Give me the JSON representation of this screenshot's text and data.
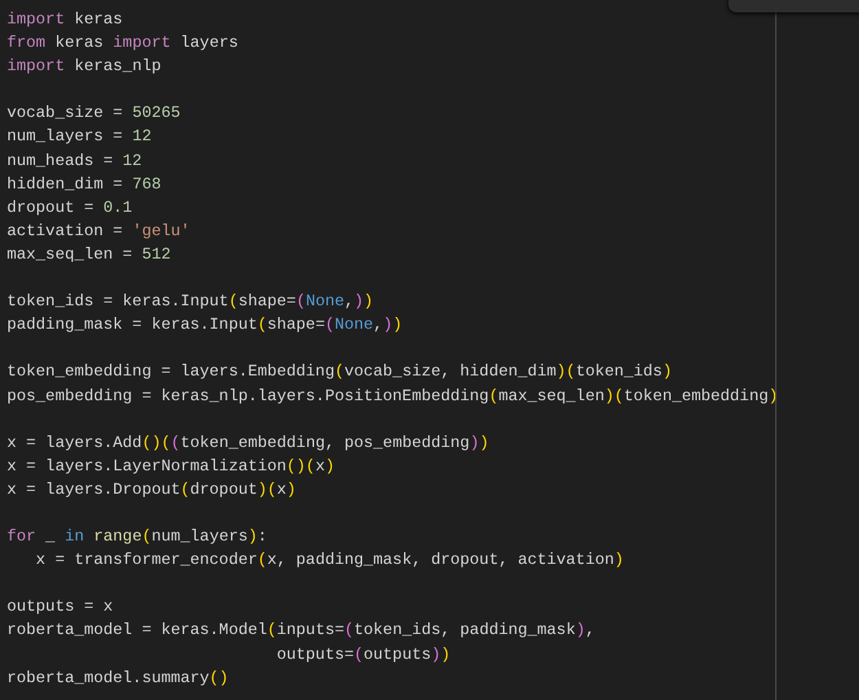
{
  "editor": {
    "lines": [
      {
        "kind": "code",
        "tokens": [
          {
            "kind": "keyword",
            "text": "import"
          },
          {
            "kind": "plain",
            "text": " keras"
          }
        ]
      },
      {
        "kind": "code",
        "tokens": [
          {
            "kind": "keyword",
            "text": "from"
          },
          {
            "kind": "plain",
            "text": " keras "
          },
          {
            "kind": "keyword",
            "text": "import"
          },
          {
            "kind": "plain",
            "text": " layers"
          }
        ]
      },
      {
        "kind": "code",
        "tokens": [
          {
            "kind": "keyword",
            "text": "import"
          },
          {
            "kind": "plain",
            "text": " keras_nlp"
          }
        ]
      },
      {
        "kind": "blank"
      },
      {
        "kind": "code",
        "tokens": [
          {
            "kind": "plain",
            "text": "vocab_size = "
          },
          {
            "kind": "number",
            "text": "50265"
          }
        ]
      },
      {
        "kind": "code",
        "tokens": [
          {
            "kind": "plain",
            "text": "num_layers = "
          },
          {
            "kind": "number",
            "text": "12"
          }
        ]
      },
      {
        "kind": "code",
        "tokens": [
          {
            "kind": "plain",
            "text": "num_heads = "
          },
          {
            "kind": "number",
            "text": "12"
          }
        ]
      },
      {
        "kind": "code",
        "tokens": [
          {
            "kind": "plain",
            "text": "hidden_dim = "
          },
          {
            "kind": "number",
            "text": "768"
          }
        ]
      },
      {
        "kind": "code",
        "tokens": [
          {
            "kind": "plain",
            "text": "dropout = "
          },
          {
            "kind": "number",
            "text": "0.1"
          }
        ]
      },
      {
        "kind": "code",
        "tokens": [
          {
            "kind": "plain",
            "text": "activation = "
          },
          {
            "kind": "string",
            "text": "'gelu'"
          }
        ]
      },
      {
        "kind": "code",
        "tokens": [
          {
            "kind": "plain",
            "text": "max_seq_len = "
          },
          {
            "kind": "number",
            "text": "512"
          }
        ]
      },
      {
        "kind": "blank"
      },
      {
        "kind": "code",
        "tokens": [
          {
            "kind": "plain",
            "text": "token_ids = keras.Input"
          },
          {
            "kind": "bracket1",
            "text": "("
          },
          {
            "kind": "plain",
            "text": "shape="
          },
          {
            "kind": "bracket2",
            "text": "("
          },
          {
            "kind": "constant",
            "text": "None"
          },
          {
            "kind": "plain",
            "text": ","
          },
          {
            "kind": "bracket2",
            "text": ")"
          },
          {
            "kind": "bracket1",
            "text": ")"
          }
        ]
      },
      {
        "kind": "code",
        "tokens": [
          {
            "kind": "plain",
            "text": "padding_mask = keras.Input"
          },
          {
            "kind": "bracket1",
            "text": "("
          },
          {
            "kind": "plain",
            "text": "shape="
          },
          {
            "kind": "bracket2",
            "text": "("
          },
          {
            "kind": "constant",
            "text": "None"
          },
          {
            "kind": "plain",
            "text": ","
          },
          {
            "kind": "bracket2",
            "text": ")"
          },
          {
            "kind": "bracket1",
            "text": ")"
          }
        ]
      },
      {
        "kind": "blank"
      },
      {
        "kind": "code",
        "tokens": [
          {
            "kind": "plain",
            "text": "token_embedding = layers.Embedding"
          },
          {
            "kind": "bracket1",
            "text": "("
          },
          {
            "kind": "plain",
            "text": "vocab_size, hidden_dim"
          },
          {
            "kind": "bracket1",
            "text": ")("
          },
          {
            "kind": "plain",
            "text": "token_ids"
          },
          {
            "kind": "bracket1",
            "text": ")"
          }
        ]
      },
      {
        "kind": "code",
        "tokens": [
          {
            "kind": "plain",
            "text": "pos_embedding = keras_nlp.layers.PositionEmbedding"
          },
          {
            "kind": "bracket1",
            "text": "("
          },
          {
            "kind": "plain",
            "text": "max_seq_len"
          },
          {
            "kind": "bracket1",
            "text": ")("
          },
          {
            "kind": "plain",
            "text": "token_embedding"
          },
          {
            "kind": "bracket1",
            "text": ")"
          }
        ]
      },
      {
        "kind": "blank"
      },
      {
        "kind": "code",
        "tokens": [
          {
            "kind": "plain",
            "text": "x = layers.Add"
          },
          {
            "kind": "bracket1",
            "text": "()("
          },
          {
            "kind": "bracket2",
            "text": "("
          },
          {
            "kind": "plain",
            "text": "token_embedding, pos_embedding"
          },
          {
            "kind": "bracket2",
            "text": ")"
          },
          {
            "kind": "bracket1",
            "text": ")"
          }
        ]
      },
      {
        "kind": "code",
        "tokens": [
          {
            "kind": "plain",
            "text": "x = layers.LayerNormalization"
          },
          {
            "kind": "bracket1",
            "text": "()("
          },
          {
            "kind": "plain",
            "text": "x"
          },
          {
            "kind": "bracket1",
            "text": ")"
          }
        ]
      },
      {
        "kind": "code",
        "tokens": [
          {
            "kind": "plain",
            "text": "x = layers.Dropout"
          },
          {
            "kind": "bracket1",
            "text": "("
          },
          {
            "kind": "plain",
            "text": "dropout"
          },
          {
            "kind": "bracket1",
            "text": ")("
          },
          {
            "kind": "plain",
            "text": "x"
          },
          {
            "kind": "bracket1",
            "text": ")"
          }
        ]
      },
      {
        "kind": "blank"
      },
      {
        "kind": "code",
        "tokens": [
          {
            "kind": "keyword",
            "text": "for"
          },
          {
            "kind": "plain",
            "text": " _ "
          },
          {
            "kind": "constant",
            "text": "in"
          },
          {
            "kind": "function",
            "text": " range"
          },
          {
            "kind": "bracket1",
            "text": "("
          },
          {
            "kind": "plain",
            "text": "num_layers"
          },
          {
            "kind": "bracket1",
            "text": ")"
          },
          {
            "kind": "plain",
            "text": ":"
          }
        ]
      },
      {
        "kind": "code",
        "tokens": [
          {
            "kind": "plain",
            "text": "   x = transformer_encoder"
          },
          {
            "kind": "bracket1",
            "text": "("
          },
          {
            "kind": "plain",
            "text": "x, padding_mask, dropout, activation"
          },
          {
            "kind": "bracket1",
            "text": ")"
          }
        ]
      },
      {
        "kind": "blank"
      },
      {
        "kind": "code",
        "tokens": [
          {
            "kind": "plain",
            "text": "outputs = x"
          }
        ]
      },
      {
        "kind": "code",
        "tokens": [
          {
            "kind": "plain",
            "text": "roberta_model = keras.Model"
          },
          {
            "kind": "bracket1",
            "text": "("
          },
          {
            "kind": "plain",
            "text": "inputs="
          },
          {
            "kind": "bracket2",
            "text": "("
          },
          {
            "kind": "plain",
            "text": "token_ids, padding_mask"
          },
          {
            "kind": "bracket2",
            "text": ")"
          },
          {
            "kind": "plain",
            "text": ","
          }
        ]
      },
      {
        "kind": "code",
        "tokens": [
          {
            "kind": "plain",
            "text": "                            outputs="
          },
          {
            "kind": "bracket2",
            "text": "("
          },
          {
            "kind": "plain",
            "text": "outputs"
          },
          {
            "kind": "bracket2",
            "text": ")"
          },
          {
            "kind": "bracket1",
            "text": ")"
          }
        ]
      },
      {
        "kind": "code",
        "tokens": [
          {
            "kind": "plain",
            "text": "roberta_model.summary"
          },
          {
            "kind": "bracket1",
            "text": "()"
          }
        ]
      }
    ]
  }
}
